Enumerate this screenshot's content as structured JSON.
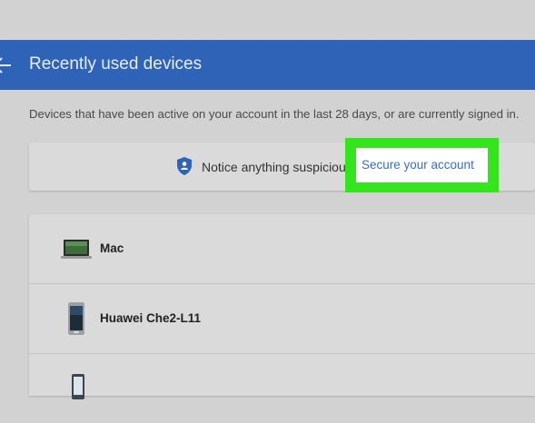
{
  "header": {
    "title": "Recently used devices"
  },
  "subtitle": "Devices that have been active on your account in the last 28 days, or are currently signed in.",
  "notice": {
    "text": "Notice anything suspicious?",
    "link_label": "Secure your account",
    "icon": "shield-icon"
  },
  "devices": [
    {
      "name": "Mac",
      "icon": "laptop-icon"
    },
    {
      "name": "Huawei Che2-L11",
      "icon": "phone-icon"
    },
    {
      "name": "",
      "icon": "phone-icon"
    }
  ],
  "colors": {
    "header_bg": "#2e63b8",
    "link": "#3a6fc4",
    "highlight": "#34e51d"
  }
}
